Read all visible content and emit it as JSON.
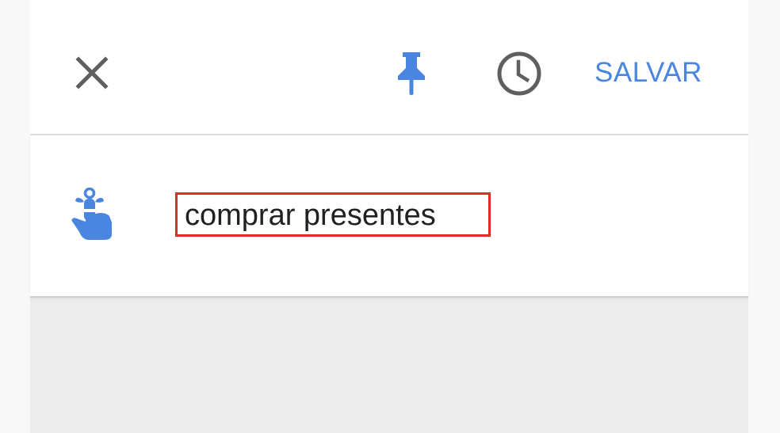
{
  "toolbar": {
    "close_icon": "close-icon",
    "pin_icon": "pushpin-icon",
    "clock_icon": "clock-icon",
    "save_label": "SALVAR"
  },
  "reminder": {
    "icon": "finger-ribbon-reminder-icon",
    "text": "comprar presentes"
  },
  "colors": {
    "accent": "#4a86e0",
    "icon_gray": "#5f5f5f",
    "highlight_border": "#d93025",
    "background": "#ececec"
  }
}
